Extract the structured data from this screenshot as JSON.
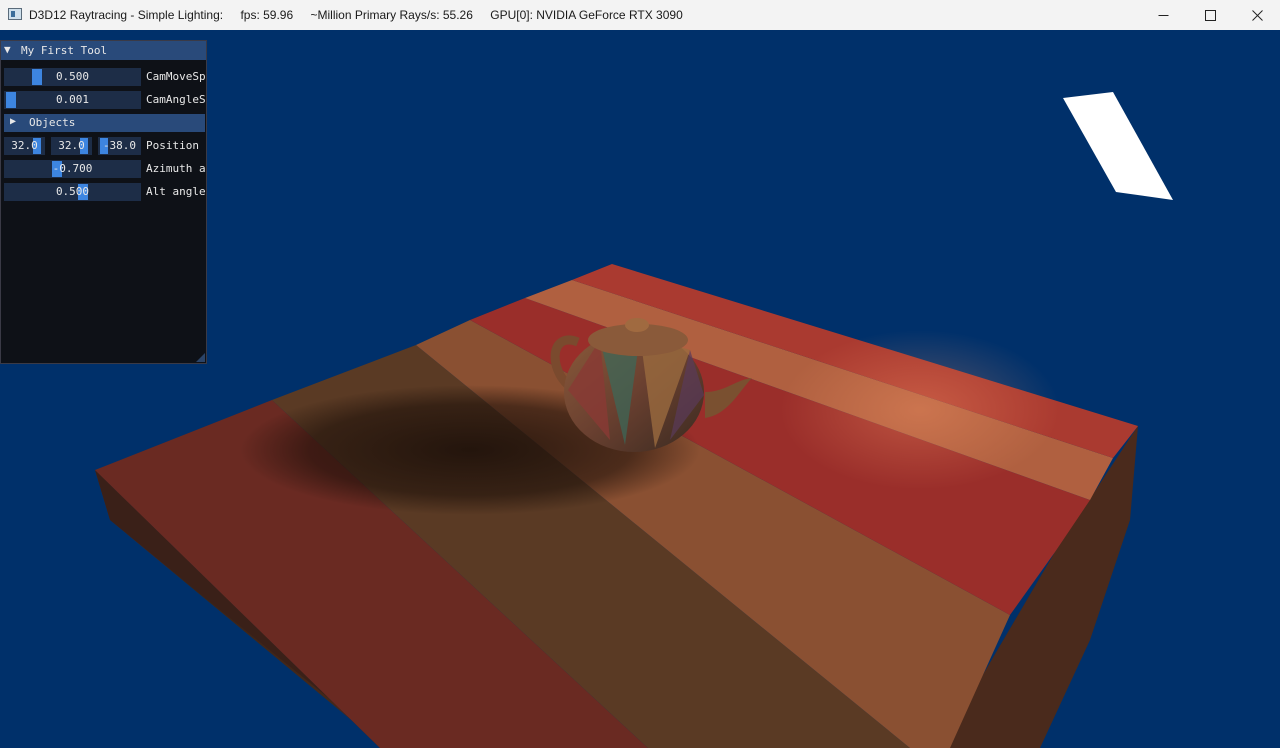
{
  "window": {
    "title": "D3D12 Raytracing - Simple Lighting:",
    "fps": "fps: 59.96",
    "rays": "~Million Primary Rays/s: 55.26",
    "gpu": "GPU[0]: NVIDIA GeForce RTX 3090",
    "minimize_icon": "minimize-icon",
    "maximize_icon": "maximize-icon",
    "close_icon": "close-icon"
  },
  "tool": {
    "title": "My First Tool",
    "cam_move_speed": {
      "value": "0.500",
      "label": "CamMoveSp",
      "fraction": 0.26
    },
    "cam_angle_speed": {
      "value": "0.001",
      "label": "CamAngleS",
      "fraction": 0.0
    },
    "objects_label": "Objects",
    "position": {
      "x": "32.0",
      "y": "32.0",
      "z": "-38.0",
      "label": "Position"
    },
    "azimuth": {
      "value": "-0.700",
      "label": "Azimuth a"
    },
    "alt_angle": {
      "value": "0.500",
      "label": "Alt angle"
    }
  },
  "colors": {
    "background": "#00306a",
    "panel_bg": "#0e1117",
    "header": "#294a7a",
    "slider_grab": "#3d85e0"
  }
}
